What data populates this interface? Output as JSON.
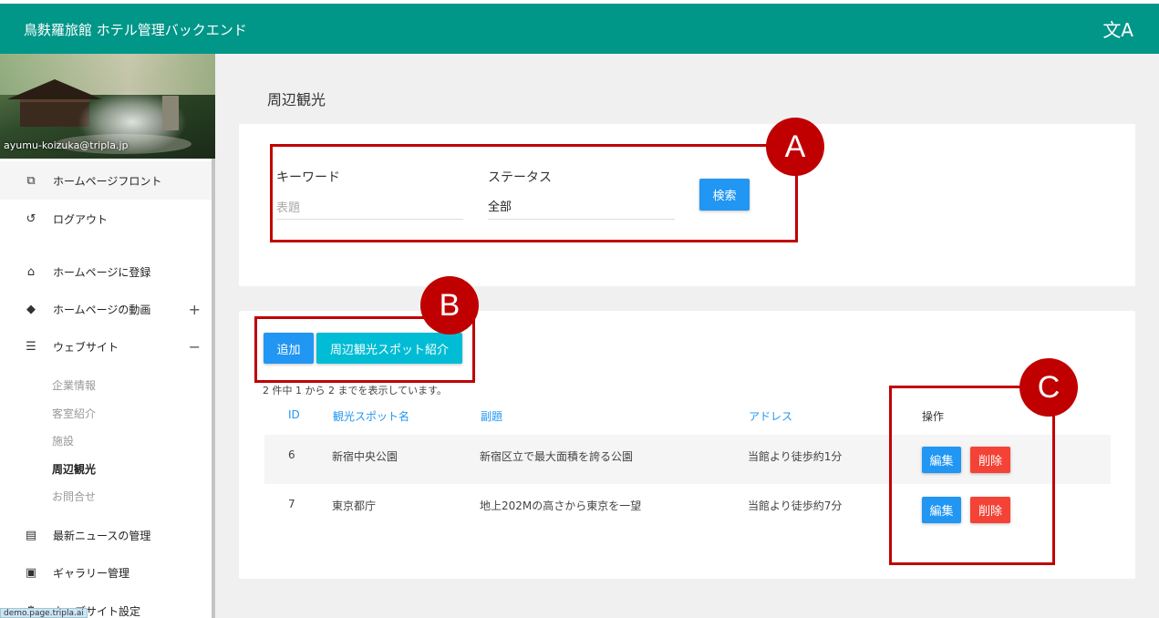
{
  "header": {
    "title": "鳥麩羅旅館 ホテル管理バックエンド",
    "lang_glyph": "文A"
  },
  "sidebar": {
    "email": "ayumu-koizuka@tripla.jp",
    "items": [
      {
        "label": "ホームページフロント",
        "icon": "⧉"
      },
      {
        "label": "ログアウト",
        "icon": "↺"
      },
      {
        "label": "ホームページに登録",
        "icon": "⌂"
      },
      {
        "label": "ホームページの動画",
        "icon": "◆",
        "toggle": "+"
      },
      {
        "label": "ウェブサイト",
        "icon": "☰",
        "toggle": "−"
      },
      {
        "label": "最新ニュースの管理",
        "icon": "▤"
      },
      {
        "label": "ギャラリー管理",
        "icon": "▣"
      },
      {
        "label": "ウェブサイト設定",
        "icon": "⚙"
      }
    ],
    "sub_items": [
      "企業情報",
      "客室紹介",
      "施設",
      "周辺観光",
      "お問合せ"
    ]
  },
  "page_title": "周辺観光",
  "search": {
    "keyword_label": "キーワード",
    "keyword_placeholder": "表題",
    "status_label": "ステータス",
    "status_value": "全部",
    "search_button": "検索"
  },
  "actions": {
    "add_button": "追加",
    "intro_button": "周辺観光スポット紹介"
  },
  "table": {
    "info": "2 件中 1 から 2 までを表示しています。",
    "headers": [
      "ID",
      "観光スポット名",
      "副題",
      "アドレス",
      "操作"
    ],
    "rows": [
      {
        "id": "6",
        "name": "新宿中央公園",
        "subtitle": "新宿区立で最大面積を誇る公園",
        "address": "当館より徒歩約1分"
      },
      {
        "id": "7",
        "name": "東京都庁",
        "subtitle": "地上202Mの高さから東京を一望",
        "address": "当館より徒歩約7分"
      }
    ],
    "edit_label": "編集",
    "delete_label": "削除"
  },
  "annotations": {
    "a": "A",
    "b": "B",
    "c": "C"
  },
  "footer_url": "demo.page.tripla.ai",
  "colors": {
    "header": "#009688",
    "primary": "#2196f3",
    "accent": "#00bcd4",
    "danger": "#f44336",
    "highlight": "#c00000"
  }
}
